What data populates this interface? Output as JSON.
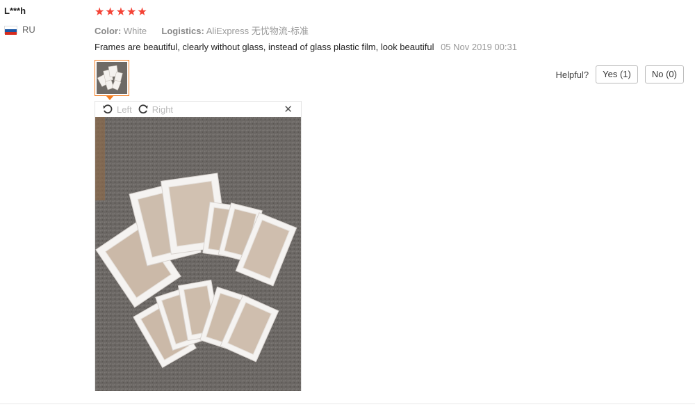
{
  "reviewer": {
    "name": "L***h",
    "country": "RU",
    "flag_icon": "russia-flag-icon"
  },
  "rating": {
    "stars": 5,
    "max": 5,
    "color": "#f44336"
  },
  "attributes": {
    "color_key": "Color:",
    "color_value": "White",
    "logistics_key": "Logistics:",
    "logistics_value": "AliExpress 无忧物流-标准"
  },
  "review": {
    "text": "Frames are beautiful, clearly without glass, instead of glass plastic film, look beautiful",
    "date": "05 Nov 2019 00:31"
  },
  "helpful": {
    "label": "Helpful?",
    "yes_label": "Yes (1)",
    "no_label": "No (0)"
  },
  "viewer": {
    "rotate_left_label": "Left",
    "rotate_right_label": "Right",
    "close_label": "✕"
  },
  "colors": {
    "accent": "#f37b1d",
    "star": "#f44336",
    "muted": "#999999"
  }
}
